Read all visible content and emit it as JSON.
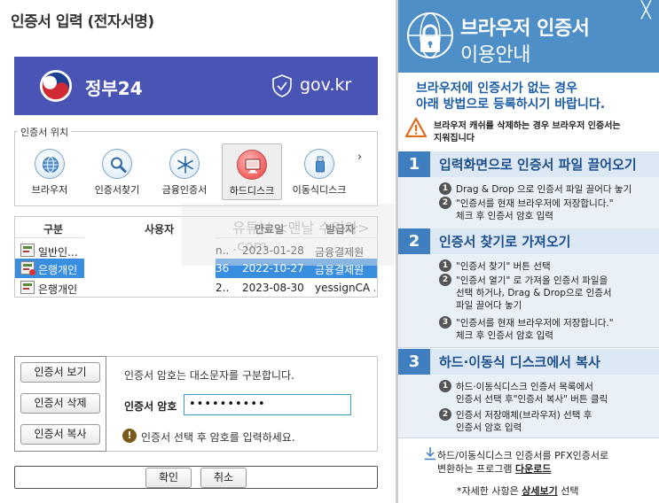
{
  "dialog": {
    "title": "인증서 입력 (전자서명)",
    "banner": {
      "gov_name": "정부24",
      "domain": "gov.kr"
    },
    "location": {
      "legend": "인증서 위치",
      "items": [
        {
          "label": "브라우저",
          "icon": "globe-icon"
        },
        {
          "label": "인증서찾기",
          "icon": "magnifier-icon"
        },
        {
          "label": "금융인증서",
          "icon": "asterisk-icon"
        },
        {
          "label": "하드디스크",
          "icon": "monitor-icon",
          "selected": true
        },
        {
          "label": "이동식디스크",
          "icon": "usb-icon"
        }
      ],
      "next": "›"
    },
    "table": {
      "headers": [
        "구분",
        "사용자",
        "만료일",
        "발급자"
      ],
      "rows": [
        {
          "type": "일반인...",
          "user": "n...",
          "expiry": "2023-01-28",
          "issuer": "금융결제원"
        },
        {
          "type": "은행개인",
          "user": "36",
          "expiry": "2022-10-27",
          "issuer": "금융결제원",
          "selected": true
        },
        {
          "type": "은행개인",
          "user": "2...",
          "expiry": "2023-08-30",
          "issuer": "yessignCA ..."
        }
      ]
    },
    "watermark": "유튜브 <맨날 수리아>  .com",
    "actions": {
      "view": "인증서 보기",
      "delete": "인증서 삭제",
      "copy": "인증서 복사"
    },
    "hint_case": "인증서 암호는 대소문자를 구분합니다.",
    "password": {
      "label": "인증서 암호",
      "value": "••••••••••"
    },
    "hint_select": "인증서 선택 후 암호를 입력하세요.",
    "buttons": {
      "ok": "확인",
      "cancel": "취소"
    }
  },
  "guide": {
    "title_line1": "브라우저 인증서",
    "title_line2": "이용안내",
    "close": "╳",
    "intro_line1": "브라우저에 인증서가 없는 경우",
    "intro_line2": "아래 방법으로 등록하시기 바랍니다.",
    "warn_line1": "브라우저 캐쉬를 삭제하는 경우 브라우저 인증서는",
    "warn_line2": "지워집니다",
    "sections": [
      {
        "num": "1",
        "title": "입력화면으로 인증서 파일 끌어오기",
        "steps": [
          {
            "n": "1",
            "lines": [
              "Drag & Drop 으로 인증서 파일 끌어다 놓기"
            ]
          },
          {
            "n": "2",
            "lines": [
              "\"인증서를 현재 브라우저에 저장합니다.\"",
              "체크 후 인증서 암호 입력"
            ]
          }
        ]
      },
      {
        "num": "2",
        "title": "인증서 찾기로 가져오기",
        "steps": [
          {
            "n": "1",
            "lines": [
              "\"인증서 찾기\" 버튼 선택"
            ]
          },
          {
            "n": "2",
            "lines": [
              "\"인증서 열기\" 로 가져올 인증서 파일을",
              "선택 하거나, Drag & Drop으로 인증서",
              "파일 끌어다 놓기"
            ]
          },
          {
            "n": "3",
            "lines": [
              "\"인증서를 현재 브라우저에 저장합니다.\"",
              "체크 후 인증서 암호 입력"
            ]
          }
        ]
      },
      {
        "num": "3",
        "title": "하드·이동식 디스크에서 복사",
        "steps": [
          {
            "n": "1",
            "lines": [
              "하드·이동식디스크 인증서 목록에서",
              "인증서 선택 후\"인증서 복사\" 버튼 클릭"
            ]
          },
          {
            "n": "2",
            "lines": [
              "인증서 저장매체(브라우저) 선택 후",
              "인증서 암호 입력"
            ]
          }
        ]
      }
    ],
    "download_line1": "하드/이동식디스크 인증서를 PFX인증서로",
    "download_line2_prefix": "변환하는 프로그램 ",
    "download_link": "다운로드",
    "detail_prefix": "*자세한 사항은 ",
    "detail_link": "상세보기",
    "detail_suffix": " 선택"
  }
}
